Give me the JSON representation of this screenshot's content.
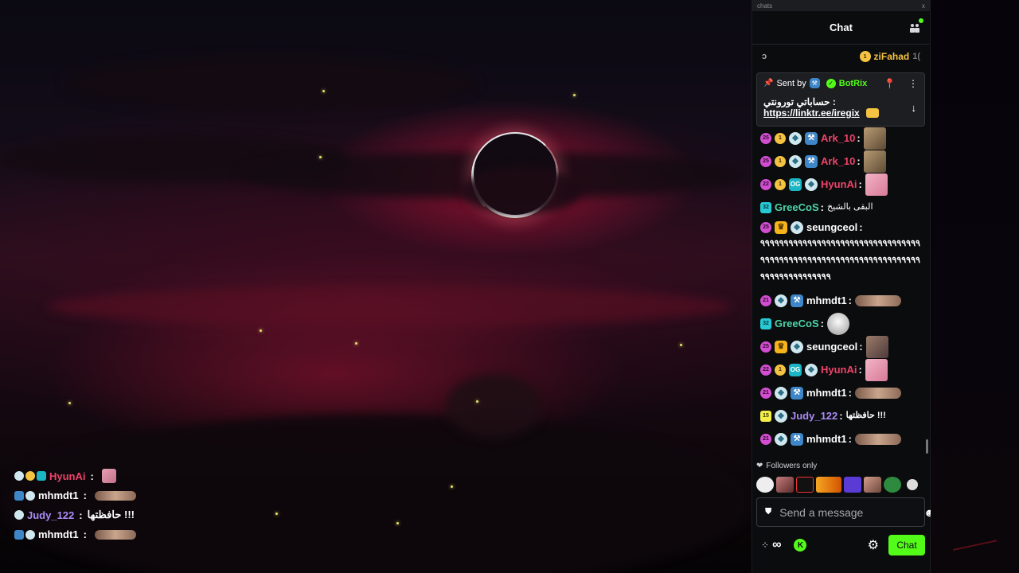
{
  "window": {
    "popout_title": "chats",
    "close": "x"
  },
  "chat": {
    "title": "Chat",
    "top_gifter": {
      "spinner": "ↄ",
      "rank": "1",
      "name": "ziFahad",
      "amount": "1("
    },
    "pinned": {
      "sent_by": "Sent by",
      "sender": "BotRix",
      "text": "حساباتي تورونتي :",
      "link": "https://linktr.ee/iregix"
    },
    "messages": [
      {
        "badges": [
          "25",
          "gift:1",
          "bird",
          "tool"
        ],
        "user": "Ark_10",
        "color": "#f0436a",
        "emote": "ark"
      },
      {
        "badges": [
          "25",
          "gift:1",
          "bird",
          "tool"
        ],
        "user": "Ark_10",
        "color": "#f0436a",
        "emote": "ark"
      },
      {
        "badges": [
          "22",
          "gift:1",
          "og",
          "bird"
        ],
        "user": "HyunAi",
        "color": "#f0436a",
        "emote": "pink"
      },
      {
        "badges": [
          "32t"
        ],
        "user": "GreeCoS",
        "color": "#4cd4a5",
        "text": "البقى بالشيخ"
      },
      {
        "badges": [
          "25",
          "crown",
          "bird"
        ],
        "user": "seungceol",
        "color": "#ffffff",
        "text": "٩٩٩٩٩٩٩٩٩٩٩٩٩٩٩٩٩٩٩٩٩٩٩٩٩٩٩٩٩٩٩٩٩٩٩٩٩٩٩٩٩٩٩٩٩٩٩٩٩٩٩٩٩٩٩٩٩٩٩٩٩٩٩٩٩٩٩٩٩٩٩٩٩٩٩٩٩٩٩٩٩٩٩"
      },
      {
        "badges": [
          "21",
          "bird",
          "tool"
        ],
        "user": "mhmdt1",
        "color": "#ffffff",
        "emote": "wide"
      },
      {
        "badges": [
          "32t"
        ],
        "user": "GreeCoS",
        "color": "#4cd4a5",
        "emote": "face"
      },
      {
        "badges": [
          "25",
          "crown",
          "bird"
        ],
        "user": "seungceol",
        "color": "#ffffff",
        "emote": "hug"
      },
      {
        "badges": [
          "22",
          "gift:1",
          "og",
          "bird"
        ],
        "user": "HyunAi",
        "color": "#f0436a",
        "emote": "pink"
      },
      {
        "badges": [
          "21",
          "bird",
          "tool"
        ],
        "user": "mhmdt1",
        "color": "#ffffff",
        "emote": "wide"
      },
      {
        "badges": [
          "15y",
          "bird"
        ],
        "user": "Judy_122",
        "color": "#a98cf5",
        "text": "حافظتها !!!"
      },
      {
        "badges": [
          "21",
          "bird",
          "tool"
        ],
        "user": "mhmdt1",
        "color": "#ffffff",
        "emote": "wide"
      }
    ],
    "followers_only": "Followers only",
    "input": {
      "placeholder": "Send a message"
    },
    "infinity": "∞",
    "send_label": "Chat"
  },
  "overlay": [
    {
      "user": "HyunAi",
      "color": "#f0436a",
      "sep": ":"
    },
    {
      "user": "mhmdt1",
      "color": "#ffffff",
      "sep": ":"
    },
    {
      "user": "Judy_122",
      "color": "#a98cf5",
      "sep": ":",
      "text": "حافظتها !!!"
    },
    {
      "user": "mhmdt1",
      "color": "#ffffff",
      "sep": ":"
    }
  ],
  "icons": {
    "users": "users-icon",
    "pin": "pin-icon",
    "more": "more-vertical-icon",
    "arrow_down": "arrow-down-icon",
    "heart": "heart-icon",
    "shield": "shield-icon",
    "smile": "smile-icon",
    "gear": "gear-icon",
    "kick": "kick-icon"
  },
  "colors": {
    "accent": "#53fc18",
    "panel_bg": "#0b0c0e"
  }
}
